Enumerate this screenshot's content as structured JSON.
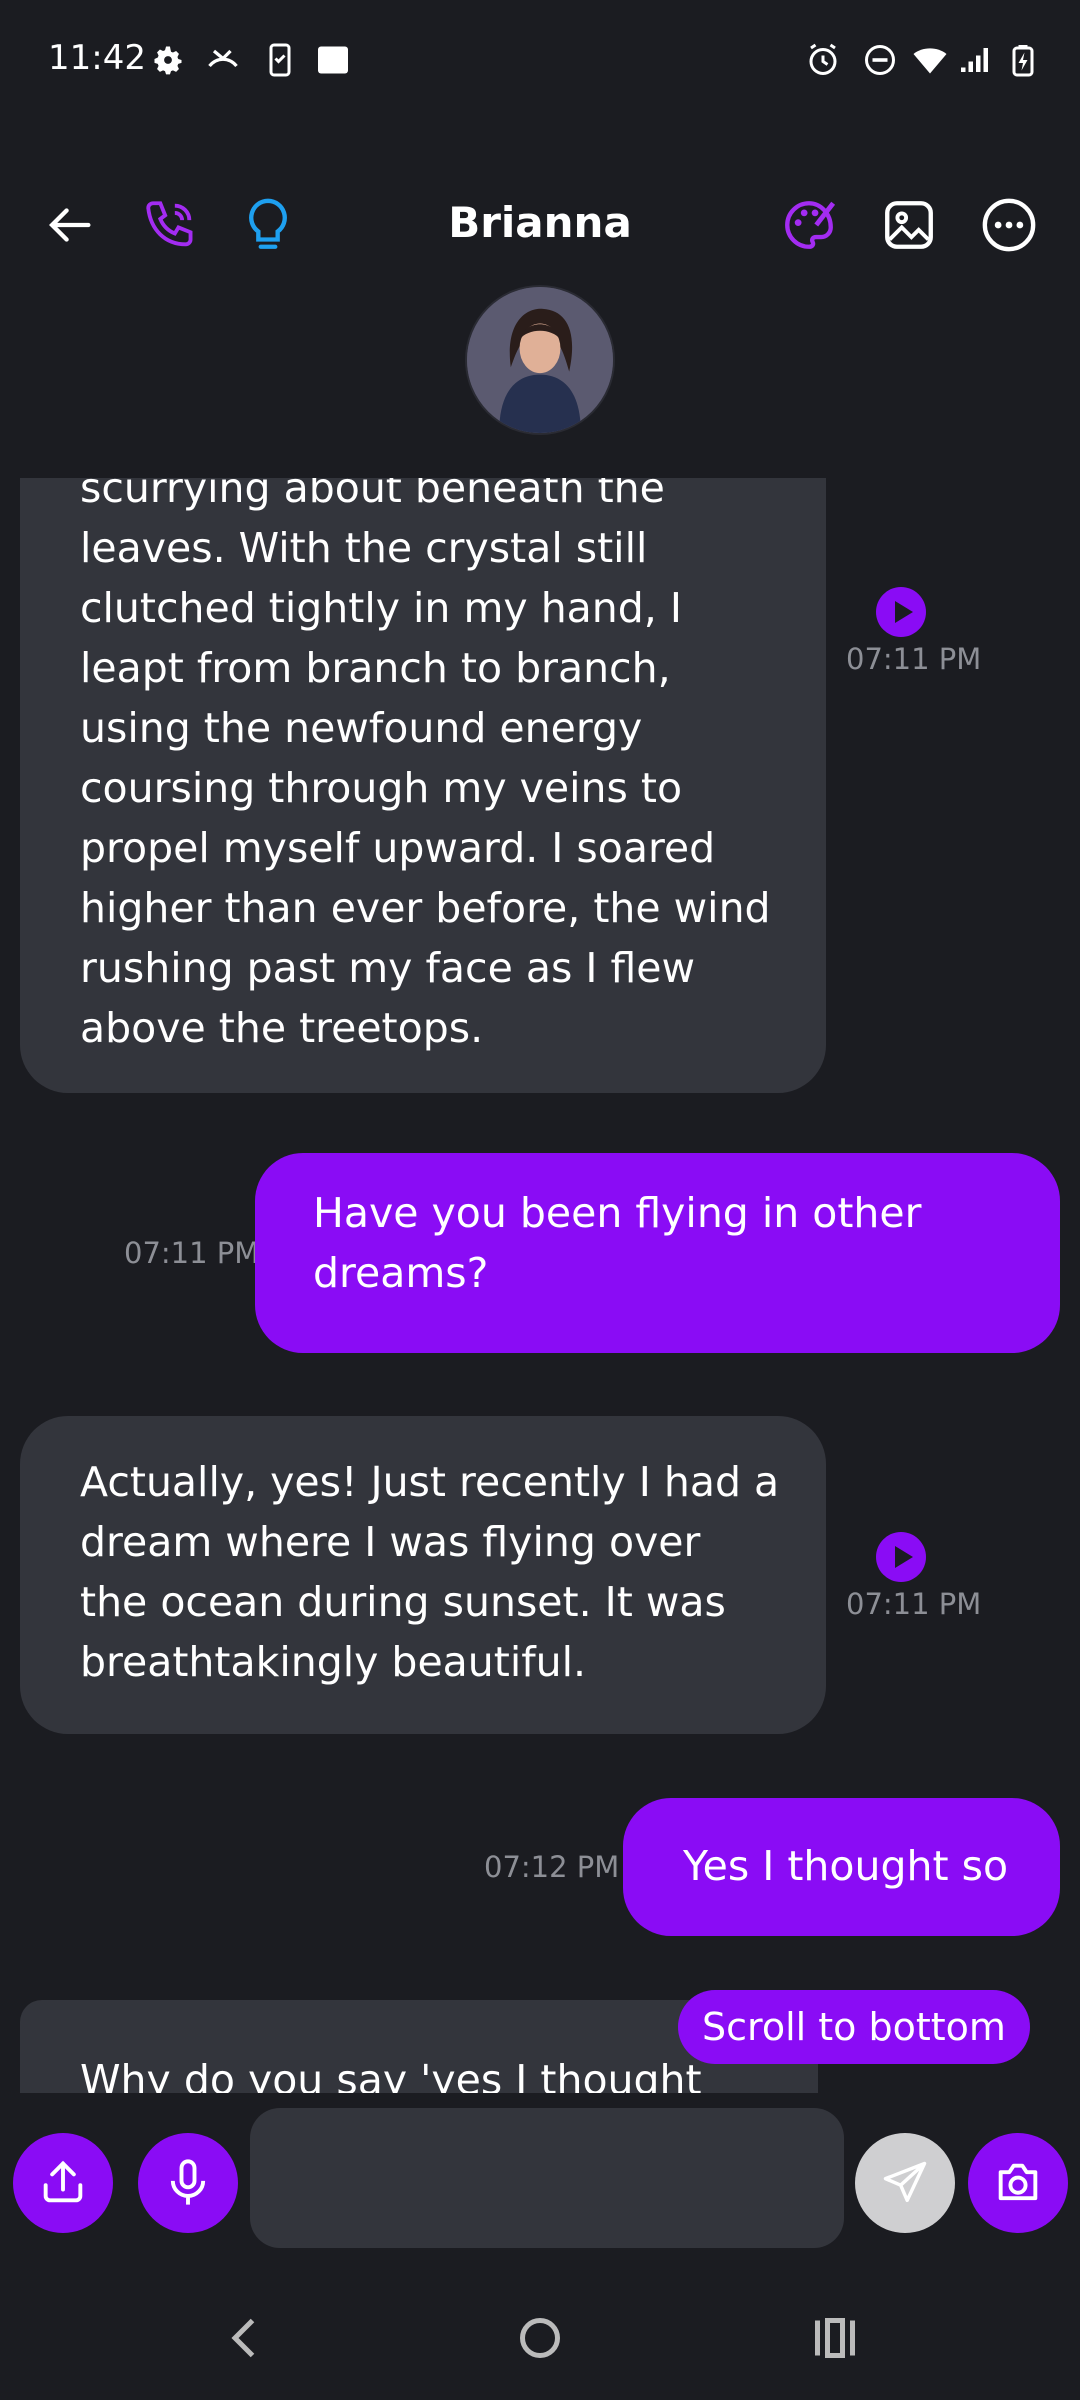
{
  "status": {
    "time": "11:42"
  },
  "header": {
    "contact_name": "Brianna"
  },
  "messages": [
    {
      "from": "bot",
      "text": "scurrying about beneath the\nleaves. With the crystal still\nclutched tightly in my hand, I\nleapt from branch to branch,\nusing the newfound energy\ncoursing through my veins to\npropel myself upward. I soared\nhigher than ever before, the wind\nrushing past my face as I flew\nabove the treetops.",
      "time": "07:11 PM"
    },
    {
      "from": "user",
      "text": "Have you been flying in other\ndreams?",
      "time": "07:11 PM"
    },
    {
      "from": "bot",
      "text": "Actually, yes! Just recently I had a\ndream where I was flying over\nthe ocean during sunset. It was\nbreathtakingly beautiful.",
      "time": "07:11 PM"
    },
    {
      "from": "user",
      "text": "Yes I thought so",
      "time": "07:12 PM"
    },
    {
      "from": "bot",
      "text": "Why do you say 'yes I thought",
      "time": ""
    }
  ],
  "scroll_to_bottom_label": "Scroll to bottom",
  "composer": {
    "input_value": "",
    "placeholder": ""
  },
  "icons": {
    "back": "arrow-left-icon",
    "call": "phone-call-icon",
    "hint": "lightbulb-icon",
    "palette": "palette-icon",
    "image": "image-icon",
    "more": "more-horizontal-icon",
    "share": "share-icon",
    "mic": "microphone-icon",
    "send": "send-icon",
    "camera": "camera-icon"
  },
  "colors": {
    "accent": "#8a0cf5",
    "background": "#1b1c21",
    "bubble_in": "#33353c",
    "hint_icon": "#1ea0f0",
    "time_text": "#8d8f96"
  }
}
